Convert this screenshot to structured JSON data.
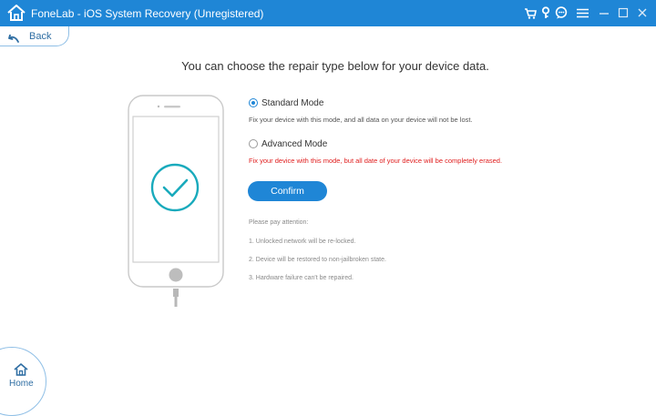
{
  "window": {
    "title": "FoneLab - iOS System Recovery (Unregistered)",
    "icons": [
      "home-icon",
      "cart-icon",
      "key-icon",
      "chat-icon",
      "menu-icon",
      "minimize-icon",
      "maximize-icon",
      "close-icon"
    ],
    "accent_color": "#1f86d6"
  },
  "nav": {
    "back_label": "Back",
    "home_label": "Home"
  },
  "main": {
    "heading": "You can choose the repair type below for your device data.",
    "modes": [
      {
        "label": "Standard Mode",
        "selected": true,
        "description": "Fix your device with this mode, and all data on your device will not be lost.",
        "warning": false
      },
      {
        "label": "Advanced Mode",
        "selected": false,
        "description": "Fix your device with this mode, but all date of your device will be completely erased.",
        "warning": true
      }
    ],
    "confirm_label": "Confirm",
    "attention": {
      "title": "Please pay attention:",
      "items": [
        "1. Unlocked network will be re-locked.",
        "2. Device will be restored to non-jailbroken state.",
        "3. Hardware failure can't be repaired."
      ]
    },
    "warning_color": "#e02020"
  }
}
